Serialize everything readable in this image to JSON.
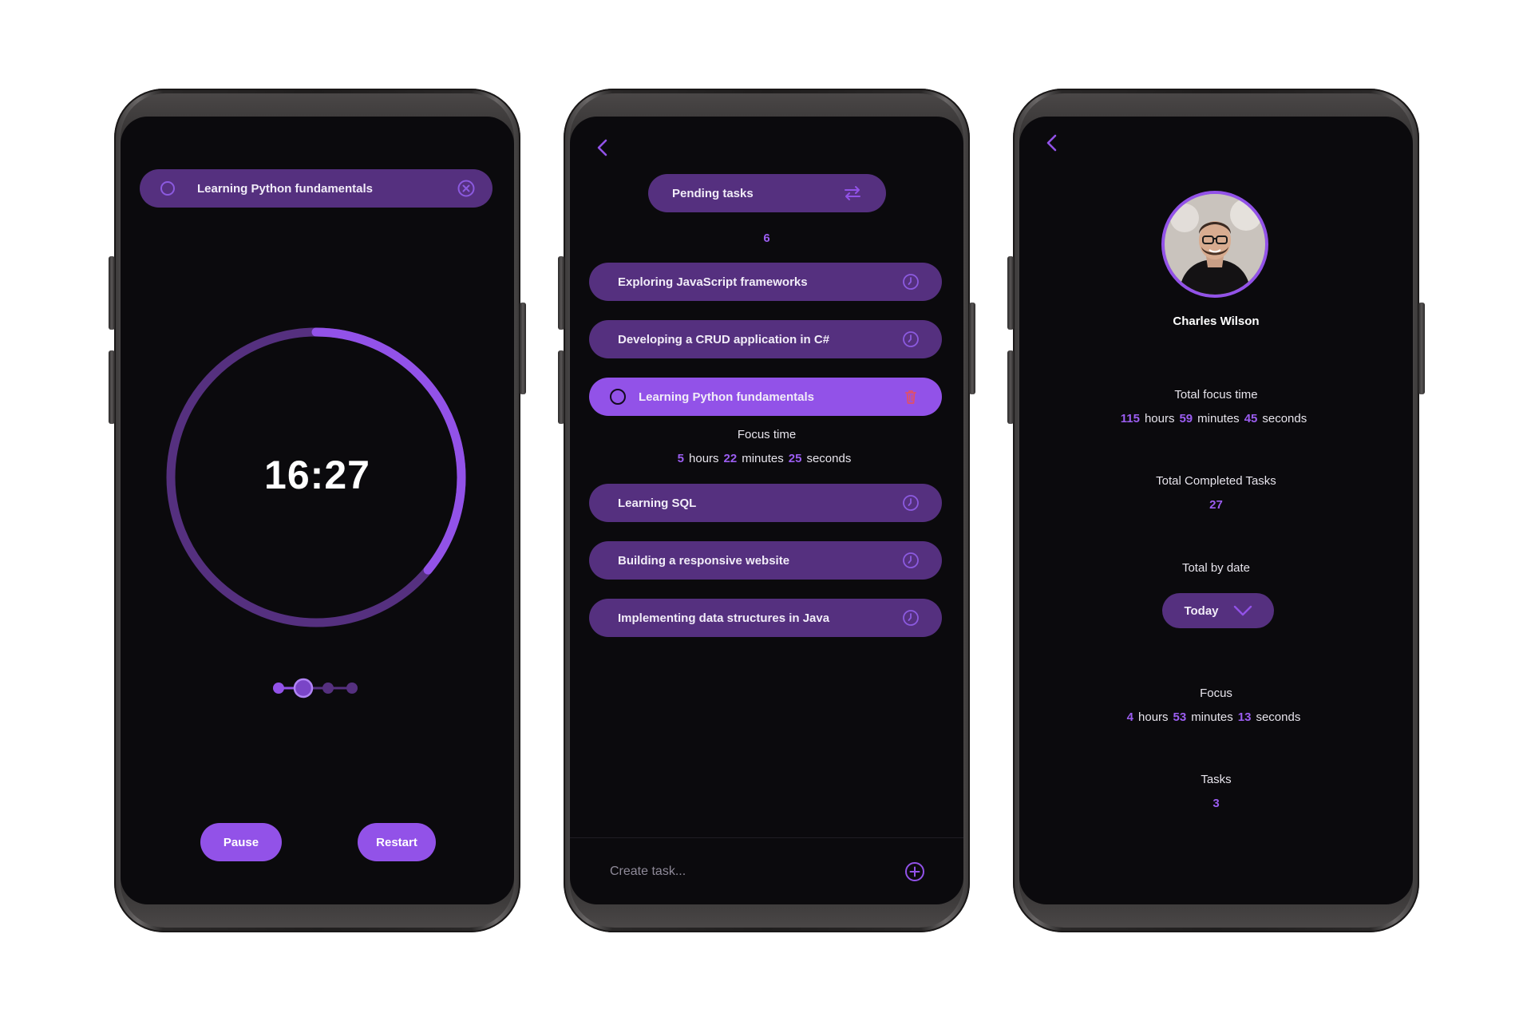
{
  "timer_screen": {
    "current_task": "Learning Python fundamentals",
    "time_remaining": "16:27",
    "timer_progress": 0.36,
    "session_step": 2,
    "session_steps_total": 4,
    "pause_label": "Pause",
    "restart_label": "Restart"
  },
  "tasks_screen": {
    "header_label": "Pending tasks",
    "pending_count": "6",
    "tasks": [
      {
        "label": "Exploring JavaScript frameworks"
      },
      {
        "label": "Developing a CRUD application in C#"
      },
      {
        "label": "Learning Python fundamentals",
        "active": true
      },
      {
        "label": "Learning SQL"
      },
      {
        "label": "Building a responsive website"
      },
      {
        "label": "Implementing data structures in Java"
      }
    ],
    "focus": {
      "title": "Focus time",
      "hours": "5",
      "hours_label": "hours",
      "minutes": "22",
      "minutes_label": "minutes",
      "seconds": "25",
      "seconds_label": "seconds"
    },
    "create_placeholder": "Create task..."
  },
  "profile_screen": {
    "name": "Charles Wilson",
    "total_focus": {
      "title": "Total focus time",
      "hours": "115",
      "hours_label": "hours",
      "minutes": "59",
      "minutes_label": "minutes",
      "seconds": "45",
      "seconds_label": "seconds"
    },
    "completed": {
      "title": "Total Completed Tasks",
      "value": "27"
    },
    "by_date": {
      "title": "Total by date",
      "selected": "Today"
    },
    "focus": {
      "title": "Focus",
      "hours": "4",
      "hours_label": "hours",
      "minutes": "53",
      "minutes_label": "minutes",
      "seconds": "13",
      "seconds_label": "seconds"
    },
    "tasks": {
      "title": "Tasks",
      "value": "3"
    }
  },
  "colors": {
    "accent": "#9252e8",
    "pill": "#55307f",
    "screen_bg": "#0b0a0d",
    "delete": "#e0506a"
  }
}
